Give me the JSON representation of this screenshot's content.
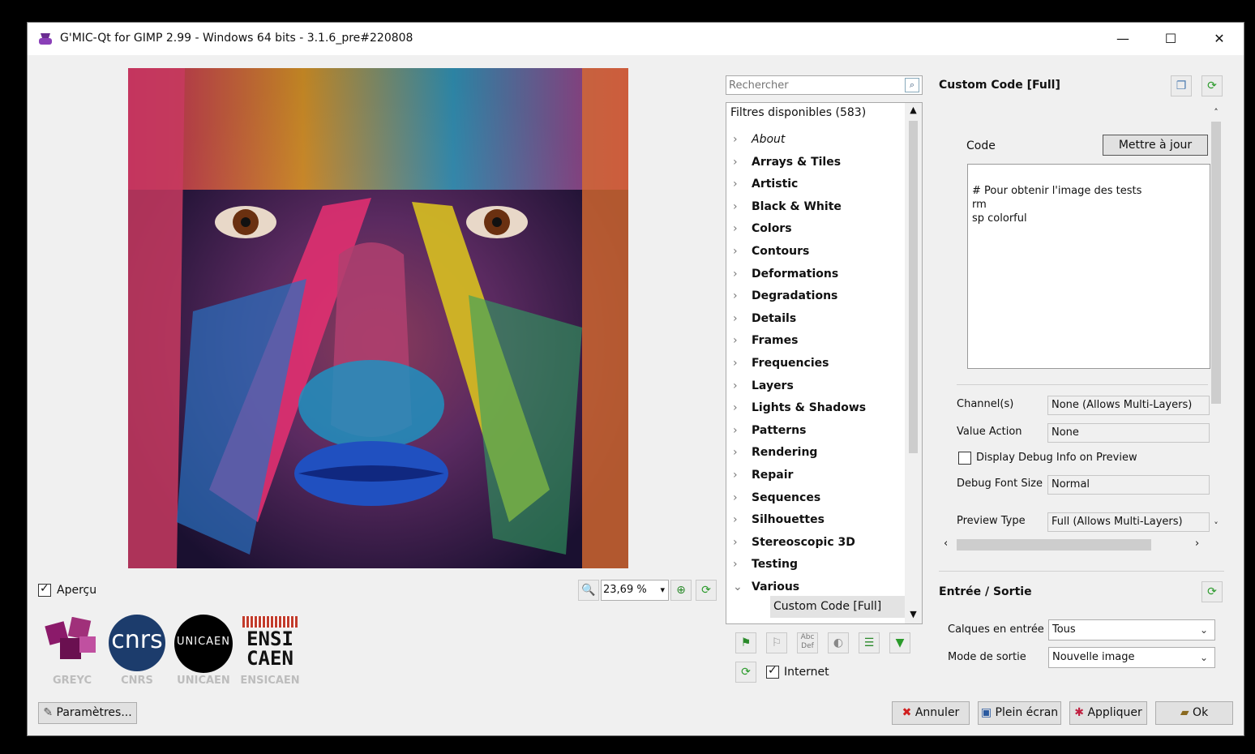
{
  "window": {
    "title": "G'MIC-Qt for GIMP 2.99 - Windows 64 bits - 3.1.6_pre#220808",
    "controls": {
      "minimize": "—",
      "maximize": "☐",
      "close": "✕"
    }
  },
  "preview": {
    "apercu_label": "Aperçu",
    "apercu_checked": true,
    "zoom_value": "23,69 %"
  },
  "logos": [
    "GREYC",
    "CNRS",
    "UNICAEN",
    "ENSICAEN"
  ],
  "logo_marks": {
    "cnrs": "cnrs",
    "unicaen": "UNICAEN",
    "ensicaen_top": "ENSI",
    "ensicaen_bottom": "CAEN"
  },
  "settings_button": "Paramètres...",
  "filters": {
    "search_placeholder": "Rechercher",
    "header": "Filtres disponibles (583)",
    "categories": [
      {
        "label": "About",
        "italic": true
      },
      {
        "label": "Arrays & Tiles"
      },
      {
        "label": "Artistic"
      },
      {
        "label": "Black & White"
      },
      {
        "label": "Colors"
      },
      {
        "label": "Contours"
      },
      {
        "label": "Deformations"
      },
      {
        "label": "Degradations"
      },
      {
        "label": "Details"
      },
      {
        "label": "Frames"
      },
      {
        "label": "Frequencies"
      },
      {
        "label": "Layers"
      },
      {
        "label": "Lights & Shadows"
      },
      {
        "label": "Patterns"
      },
      {
        "label": "Rendering"
      },
      {
        "label": "Repair"
      },
      {
        "label": "Sequences"
      },
      {
        "label": "Silhouettes"
      },
      {
        "label": "Stereoscopic 3D"
      },
      {
        "label": "Testing"
      },
      {
        "label": "Various",
        "expanded": true
      }
    ],
    "selected_child": "Custom Code [Full]",
    "internet_label": "Internet",
    "internet_checked": true
  },
  "filter_panel": {
    "title": "Custom Code [Full]",
    "code_label": "Code",
    "update_button": "Mettre à jour",
    "code_lines": [
      "# Pour obtenir l'image des tests",
      "rm",
      "sp colorful"
    ],
    "params": [
      {
        "label": "Channel(s)",
        "value": "None (Allows Multi-Layers)"
      },
      {
        "label": "Value Action",
        "value": "None"
      }
    ],
    "debug_checkbox": "Display Debug Info on Preview",
    "debug_checked": false,
    "font_size": {
      "label": "Debug Font Size",
      "value": "Normal"
    },
    "preview_type": {
      "label": "Preview Type",
      "value": "Full (Allows Multi-Layers)"
    }
  },
  "io": {
    "title": "Entrée / Sortie",
    "input_label": "Calques en entrée",
    "input_value": "Tous",
    "output_label": "Mode de sortie",
    "output_value": "Nouvelle image"
  },
  "buttons": {
    "cancel": "Annuler",
    "fullscreen": "Plein écran",
    "apply": "Appliquer",
    "ok": "Ok"
  }
}
